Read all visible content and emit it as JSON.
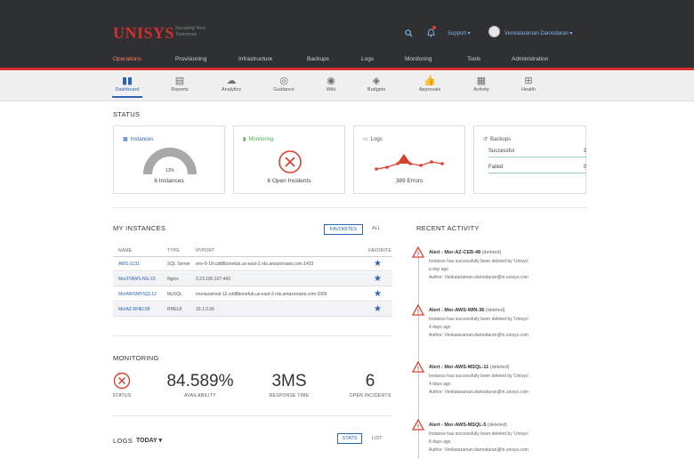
{
  "header": {
    "logo": "UNISYS",
    "tagline": "Securing Your Tomorrow",
    "support": "Support ▾",
    "user": "Venkataraman Damodaran ▾"
  },
  "main_nav": [
    "Operations",
    "Provisioning",
    "Infrastructure",
    "Backups",
    "Logs",
    "Monitoring",
    "Tools",
    "Administration"
  ],
  "sub_nav": [
    {
      "label": "Dashboard",
      "icon": "bar-chart-icon"
    },
    {
      "label": "Reports",
      "icon": "document-icon"
    },
    {
      "label": "Analytics",
      "icon": "cloud-icon"
    },
    {
      "label": "Guidance",
      "icon": "compass-icon"
    },
    {
      "label": "Wiki",
      "icon": "globe-icon"
    },
    {
      "label": "Budgets",
      "icon": "coins-icon"
    },
    {
      "label": "Approvals",
      "icon": "thumbs-up-icon"
    },
    {
      "label": "Activity",
      "icon": "clipboard-icon"
    },
    {
      "label": "Health",
      "icon": "health-icon"
    }
  ],
  "status": {
    "title": "STATUS",
    "instances": {
      "title": "Instances",
      "gauge_pct": "13%",
      "gauge_value": 0.13,
      "caption": "6 Instances"
    },
    "monitoring": {
      "title": "Monitoring",
      "caption": "6 Open Incidents"
    },
    "logs": {
      "title": "Logs",
      "caption": "389 Errors"
    },
    "backups": {
      "title": "Backups",
      "rows": [
        {
          "label": "Successful",
          "value": "3"
        },
        {
          "label": "Failed",
          "value": "0"
        }
      ]
    }
  },
  "instances": {
    "title": "MY INSTANCES",
    "favorites_label": "FAVORITES",
    "all_label": "ALL",
    "columns": [
      "NAME",
      "TYPE",
      "IP/PORT",
      "FAVORITE"
    ],
    "rows": [
      {
        "name": "AWS-3131",
        "type": "SQL Server",
        "endpoint": "env-9-18-cdd8bonefub.us-east-2.rds.amazonaws.com:1433"
      },
      {
        "name": "Mor3TAWS-NG-15",
        "type": "Nginx",
        "endpoint": "3.23.190.107:443"
      },
      {
        "name": "MorAWSMYSQL12",
        "type": "MySQL",
        "endpoint": "monavamssl-12.cdd8bonefub.us-east-2.rds.amazonaws.com:3306"
      },
      {
        "name": "MorAZ-RHEL58",
        "type": "RHEL8",
        "endpoint": "10.1.0.96"
      }
    ]
  },
  "monitoring": {
    "title": "MONITORING",
    "items": [
      {
        "value": "",
        "label": "STATUS"
      },
      {
        "value": "84.589%",
        "label": "AVAILABILITY"
      },
      {
        "value": "3MS",
        "label": "RESPONSE TIME"
      },
      {
        "value": "6",
        "label": "OPEN INCIDENTS"
      }
    ]
  },
  "logs": {
    "title": "LOGS",
    "period": "TODAY ▾",
    "stats_label": "STATS",
    "list_label": "LIST"
  },
  "activity": {
    "title": "RECENT ACTIVITY",
    "items": [
      {
        "title": "Alert - Mor-AZ-CEB-48",
        "tag": "(deleted)",
        "desc": "Instance has successfully been deleted by 'Unisys'.",
        "time": "a day ago",
        "author": "Author: Venkataraman.damodaran@in.unisys.com"
      },
      {
        "title": "Alert - Mor-AWS-WIN-36",
        "tag": "(deleted)",
        "desc": "Instance has successfully been deleted by 'Unisys'.",
        "time": "4 days ago",
        "author": "Author: Venkataraman.damodaran@in.unisys.com"
      },
      {
        "title": "Alert - Mor-AWS-MSQL-11",
        "tag": "(deleted)",
        "desc": "Instance has successfully been deleted by 'Unisys'.",
        "time": "4 days ago",
        "author": "Author: Venkataraman.damodaran@in.unisys.com"
      },
      {
        "title": "Alert - Mor-AWS-MSQL-5",
        "tag": "(deleted)",
        "desc": "Instance has successfully been deleted by 'Unisys'.",
        "time": "8 days ago",
        "author": "Author: Venkataraman.damodaran@in.unisys.com"
      }
    ]
  },
  "colors": {
    "accent": "#2d64b3",
    "brand_red": "#d32f2f",
    "header_bg": "#2f3033"
  }
}
